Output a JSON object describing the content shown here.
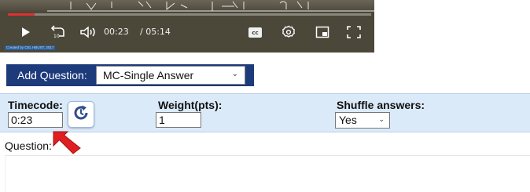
{
  "player": {
    "current_time": "00:23",
    "duration": "/ 05:14",
    "progress": 0.073,
    "credit": "Created by CEL HBUST, 2017",
    "cc_label": "cc",
    "icons": [
      "play-icon",
      "rewind-10-icon",
      "volume-icon",
      "cc-icon",
      "settings-icon",
      "picture-in-picture-icon",
      "fullscreen-icon"
    ]
  },
  "add_question": {
    "label": "Add Question:",
    "type_selected": "MC-Single Answer"
  },
  "options": {
    "timecode_label": "Timecode:",
    "timecode_value": "0:23",
    "weight_label": "Weight(pts):",
    "weight_value": "1",
    "shuffle_label": "Shuffle answers:",
    "shuffle_value": "Yes"
  },
  "question": {
    "label": "Question:"
  },
  "colors": {
    "accent_dark_blue": "#1d3a7a",
    "options_bg": "#dbeaf9",
    "progress_red": "#e03030",
    "arrow_red": "#e02020"
  }
}
